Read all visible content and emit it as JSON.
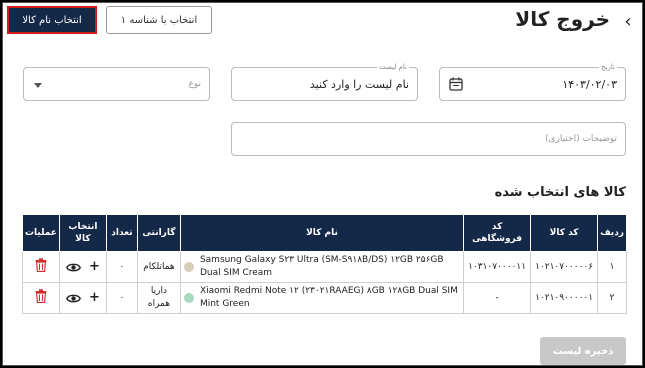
{
  "header": {
    "title": "خروج کالا",
    "select_by_name_label": "انتخاب نام کالا",
    "select_by_id_label": "انتخاب با شناسه ۱"
  },
  "form": {
    "date": {
      "label": "تاریخ",
      "value": "۱۴۰۳/۰۲/۰۳"
    },
    "list_name": {
      "label": "نام لیست",
      "value": "نام لیست را وارد کنید"
    },
    "type": {
      "placeholder": "نوع"
    },
    "description": {
      "placeholder": "توضیحات (اختیاری)"
    }
  },
  "section_title": "کالا های انتخاب شده",
  "table": {
    "headers": {
      "row": "ردیف",
      "code": "کد کالا",
      "store_code": "کد فروشگاهی",
      "name": "نام کالا",
      "warranty": "گارانتی",
      "qty": "تعداد",
      "select": "انتخاب کالا",
      "actions": "عملیات"
    },
    "rows": [
      {
        "index": "۱",
        "code": "۱۰۲۱۰۷۰۰۰۰۰۶",
        "store_code": "۱۰۳۱۰۷۰۰۰۰۱۱",
        "name": "Samsung Galaxy S۲۳ Ultra (SM-S۹۱۸B/DS) ۱۲GB ۲۵۶GB Dual SIM Cream",
        "color": "#d8cdb8",
        "warranty": "هماتلکام",
        "qty": "۰"
      },
      {
        "index": "۲",
        "code": "۱۰۲۱۰۹۰۰۰۰۰۱",
        "store_code": "-",
        "name": "Xiaomi Redmi Note ۱۲ (۲۳۰۲۱RAAEG) ۸GB ۱۲۸GB Dual SIM Mint Green",
        "color": "#a9d9bf",
        "warranty": "داریا همراه",
        "qty": "۰"
      }
    ]
  },
  "save_label": "ذخیره لیست",
  "colors": {
    "primary": "#142848",
    "trash": "#d32f2f",
    "highlight": "#d01c1c"
  }
}
